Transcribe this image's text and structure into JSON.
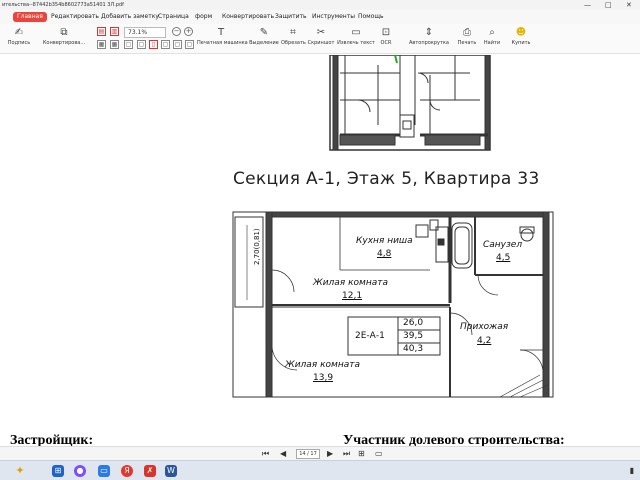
{
  "window": {
    "title": "ительства--87442b354b8602773a51401 3Л.pdf",
    "minimize": "—",
    "maximize": "□",
    "close": "✕"
  },
  "menu": {
    "items": [
      "Главная",
      "Редактировать",
      "Добавить заметку",
      "Страница",
      "форм",
      "Конвертировать",
      "Защитить",
      "Инструменты",
      "Помощь"
    ]
  },
  "toolbar": {
    "sign": "Подпись",
    "convert": "Конвертирова...",
    "zoom": "73.1%",
    "typewriter": "Печатная машинка",
    "highlight": "Выделение",
    "crop": "Обрезать",
    "screenshot": "Скриншот",
    "extract": "Извлечь текст",
    "ocr": "OCR",
    "autoscroll": "Автопрокрутка",
    "print": "Печать",
    "find": "Найти",
    "buy": "Купить"
  },
  "document": {
    "section_title": "Секция А-1, Этаж 5, Квартира 33",
    "balcony_dim": "2,70(0,81)",
    "rooms": {
      "kitchen": "Кухня ниша",
      "kitchen_area": "4,8",
      "bath": "Санузел",
      "bath_area": "4,5",
      "living1": "Жилая комната",
      "living1_area": "12,1",
      "hall": "Прихожая",
      "hall_area": "4,2",
      "living2": "Жилая комната",
      "living2_area": "13,9"
    },
    "legend": {
      "code": "2Е-А-1",
      "v1": "26,0",
      "v2": "39,5",
      "v3": "40,3"
    },
    "developer": "Застройщик:",
    "participant": "Участник долевого строительства:"
  },
  "pagenav": {
    "page": "14 / 17"
  },
  "colors": {
    "accent": "#e8453c",
    "wall": "#333333"
  }
}
